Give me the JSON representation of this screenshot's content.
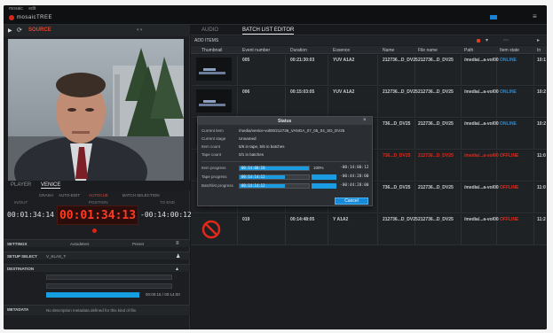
{
  "menubar": {
    "menus": [
      "mosaic",
      "edit"
    ],
    "brand": "mosaicTREE",
    "colors": {
      "brand_red": "#d42a1e",
      "status_blue": "#1c7fd6"
    }
  },
  "player": {
    "source_label": "SOURCE",
    "play_icon": "play-icon",
    "loop_icon": "loop-icon",
    "tabs": [
      "PLAYER",
      "VENICE"
    ],
    "cues": [
      "CRASH",
      "AUTO-EDIT",
      "AUTOCUE",
      "BATCH SELECTION"
    ],
    "tc_labels": {
      "in": "IN/OUT",
      "position": "POSITION",
      "to_end": "TO END"
    },
    "tc_in": "00:01:34:14",
    "tc_position": "00:01:34:13",
    "tc_remaining": "-00:14:00:12"
  },
  "settings": {
    "label": "SETTINGS",
    "value1": "Autodetect",
    "value2": "Preset"
  },
  "setup_select": {
    "label": "SETUP SELECT",
    "value": "V_KLAS_T"
  },
  "destination": {
    "label": "DESTINATION",
    "progress_value": "00:00:15 / 00:14:00",
    "progress_fraction": 0.74
  },
  "metadata": {
    "label": "METADATA",
    "message": "No description metadata defined for this kind of file."
  },
  "batch": {
    "tabs": [
      "AUDIO",
      "BATCH LIST EDITOR"
    ],
    "add_label": "ADD ITEMS",
    "columns": [
      "Thumbnail",
      "Event number",
      "Duration",
      "Essence",
      "Name",
      "File name",
      "Path",
      "Item state",
      "In"
    ],
    "rows": [
      {
        "event": "005",
        "duration": "00:21:30:03",
        "essence": "YUV A1A2",
        "name": "212736...D_DV25",
        "file": "212736...D_DV25",
        "path": "/media/...a-vol00",
        "state": "ONLINE",
        "in": "10:1",
        "state_type": "online",
        "thumb": "video"
      },
      {
        "event": "006",
        "duration": "00:15:03:05",
        "essence": "YUV A1A2",
        "name": "212736...D_DV25",
        "file": "212736...D_DV25",
        "path": "/media/...a-vol00",
        "state": "ONLINE",
        "in": "10:2",
        "state_type": "online",
        "thumb": "video"
      },
      {
        "event": "",
        "duration": "",
        "essence": "",
        "name": "736...D_DV25",
        "file": "212736...D_DV25",
        "path": "/media/...a-vol00",
        "state": "ONLINE",
        "in": "10:2",
        "state_type": "online",
        "thumb": "video"
      },
      {
        "event": "",
        "duration": "",
        "essence": "",
        "name": "736...D_DV25",
        "file": "212736...D_DV25",
        "path": "/media/...a-vol00",
        "state": "OFFLINE",
        "in": "11:0",
        "state_type": "offline",
        "thumb": "video"
      },
      {
        "event": "",
        "duration": "",
        "essence": "",
        "name": "736...D_DV25",
        "file": "212736...D_DV25",
        "path": "/media/...a-vol00",
        "state": "OFFLINE",
        "in": "11:0",
        "state_type": "offline",
        "thumb": "none"
      },
      {
        "event": "019",
        "duration": "00:14:48:05",
        "essence": "Y A1A2",
        "name": "212736...D_DV25",
        "file": "212736...D_DV25",
        "path": "/media/...a-vol00",
        "state": "OFFLINE",
        "in": "11:2",
        "state_type": "offline",
        "thumb": "none"
      }
    ],
    "colors": {
      "online": "#1c8fe0",
      "offline": "#e3281a"
    }
  },
  "status_dialog": {
    "title": "Status",
    "current_item_label": "Current item",
    "current_item_value": "/media/venice-vol00/212736_VANGA_07_05_04_SD_DV25",
    "current_stage_label": "Current stage",
    "current_stage_value": "Unnamed",
    "item_count_label": "Item count",
    "item_count_value": "5/6 in tape, 5/6 in batches",
    "tape_count_label": "Tape count",
    "tape_count_value": "0/1 in batches",
    "item_progress_label": "Item progress",
    "item_progress_text": "00:14:00:18",
    "item_progress_pct": "100%",
    "item_progress_time": "-00:14:00:12",
    "tape_progress_label": "Tape progress",
    "tape_progress_text": "00:14:14:12",
    "tape_progress_time": "-00:44:28:00",
    "batchlist_progress_label": "Batchlist progress",
    "batchlist_progress_text": "00:14:14:12",
    "batchlist_progress_time": "-00:44:28:00",
    "item_fraction": 1.0,
    "tape_fraction": 0.66,
    "batchlist_fraction": 0.66,
    "cancel_label": "Cancel"
  }
}
